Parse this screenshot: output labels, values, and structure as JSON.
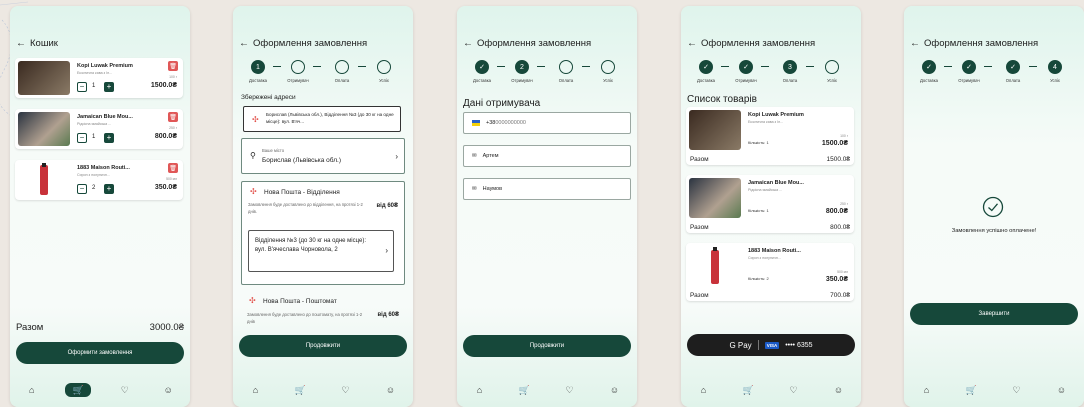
{
  "colors": {
    "accent": "#16483a",
    "delete": "#e05757",
    "pin": "#e2504a"
  },
  "nav_icons": [
    "home-icon",
    "cart-icon",
    "heart-icon",
    "profile-icon"
  ],
  "cart": {
    "title": "Кошик",
    "items": [
      {
        "name": "Kopi Luwak Premium",
        "sub": "Екзотична кава з Ін...",
        "weight": "100 г",
        "qty": "1",
        "price": "1500.0₴"
      },
      {
        "name": "Jamaican Blue Mou...",
        "sub": "Рідкісна ямайська ...",
        "weight": "250 г",
        "qty": "1",
        "price": "800.0₴"
      },
      {
        "name": "1883 Maison Routi...",
        "sub": "Сироп з полуничн...",
        "weight": "500 мл",
        "qty": "2",
        "price": "350.0₴"
      }
    ],
    "total_label": "Разом",
    "total": "3000.0₴",
    "button": "Оформити замовлення"
  },
  "checkout": {
    "title": "Оформлення замовлення",
    "steps": [
      "Доставка",
      "Отримувач",
      "Оплата",
      "Успіх"
    ],
    "saved_label": "Збережені адреси",
    "saved_address": "Борислав (Львівська обл.), Відділення №3 (до 30 кг на одне місце): вул. В'яч...",
    "city_label": "Ваше місто",
    "city_value": "Борислав (Львівська обл.)",
    "np1_title": "Нова Пошта - Відділення",
    "np1_desc": "Замовлення буде доставлено до відділення, на протязі 1-2 днів.",
    "np1_price": "від 60₴",
    "branch": "Відділення №3 (до 30 кг на одне місце): вул. В'ячеслава Чорновола, 2",
    "np2_title": "Нова Пошта - Поштомат",
    "np2_desc": "Замовлення буде доставлено до поштомату, на протязі 1-2 днів",
    "np2_price": "від 60₴",
    "button": "Продовжити"
  },
  "recipient": {
    "title": "Дані отримувача",
    "phone_prefix": "+38",
    "phone": "0000000000",
    "first_name": "Артем",
    "last_name": "Наумов",
    "button": "Продовжити"
  },
  "summary": {
    "title": "Список товарів",
    "qty_label": "Кількість:",
    "sum_label": "Разом",
    "items": [
      {
        "name": "Kopi Luwak Premium",
        "sub": "Екзотична кава з Ін...",
        "weight": "100 г",
        "qty": "1",
        "price": "1500.0₴",
        "sum": "1500.0₴"
      },
      {
        "name": "Jamaican Blue Mou...",
        "sub": "Рідкісна ямайська ...",
        "weight": "250 г",
        "qty": "1",
        "price": "800.0₴",
        "sum": "800.0₴"
      },
      {
        "name": "1883 Maison Routi...",
        "sub": "Сироп з полуничн...",
        "weight": "500 мл",
        "qty": "2",
        "price": "350.0₴",
        "sum": "700.0₴"
      }
    ],
    "gpay": "G Pay",
    "card_brand": "VISA",
    "card_mask": "•••• 6355"
  },
  "success": {
    "message": "Замовлення успішно оплачене!",
    "button": "Завершити",
    "step4": "4"
  }
}
